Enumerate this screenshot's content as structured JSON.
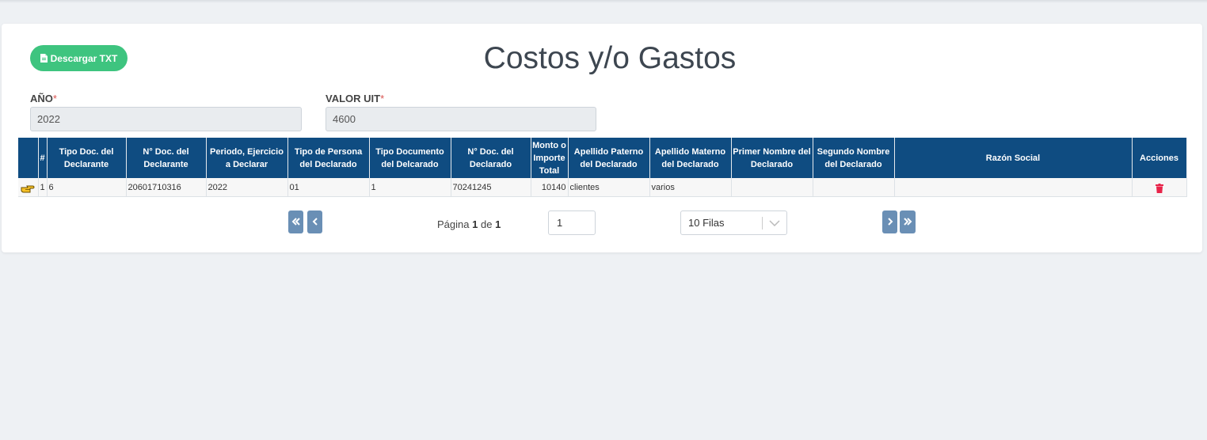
{
  "toolbar": {
    "download_label": "Descargar TXT"
  },
  "page": {
    "title": "Costos y/o Gastos"
  },
  "fields": {
    "year": {
      "label": "AÑO",
      "required_mark": "*",
      "value": "2022"
    },
    "uit": {
      "label": "VALOR UIT",
      "required_mark": "*",
      "value": "4600"
    }
  },
  "table": {
    "headers": [
      "#",
      "Tipo Doc. del Declarante",
      "N° Doc. del Declarante",
      "Periodo, Ejercicio a Declarar",
      "Tipo de Persona del Declarado",
      "Tipo Documento del Delcarado",
      "N° Doc. del Declarado",
      "Monto o Importe Total",
      "Apellido Paterno del Declarado",
      "Apellido Materno del Declarado",
      "Primer Nombre del Declarado",
      "Segundo Nombre del Declarado",
      "Razón Social",
      "Acciones"
    ],
    "rows": [
      {
        "row_num": "1",
        "tipo_doc_declarante": "6",
        "num_doc_declarante": "20601710316",
        "periodo": "2022",
        "tipo_persona": "01",
        "tipo_documento": "1",
        "num_doc_declarado": "70241245",
        "monto": "10140",
        "apellido_paterno": "clientes",
        "apellido_materno": "varios",
        "primer_nombre": "",
        "segundo_nombre": "",
        "razon_social": ""
      }
    ]
  },
  "pagination": {
    "page_prefix": "Página",
    "current_page": "1",
    "of_label": "de",
    "total_pages": "1",
    "page_input_value": "1",
    "rows_per_page": "10 Filas"
  },
  "icons": {
    "download": "file-icon",
    "row_pointer": "hand-pointer-icon",
    "delete": "trash-icon",
    "first": "double-chevron-left-icon",
    "prev": "chevron-left-icon",
    "next": "chevron-right-icon",
    "last": "double-chevron-right-icon",
    "select": "chevron-down-icon"
  },
  "colors": {
    "header_bg": "#0f4c81",
    "download_button": "#3ec47f",
    "pager_button": "#6a8fb5",
    "delete_icon": "#e8244a",
    "pointer_icon": "#f6c026"
  }
}
